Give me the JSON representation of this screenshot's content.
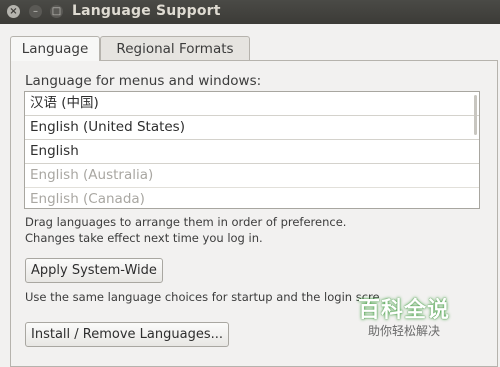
{
  "window": {
    "title": "Language Support",
    "close_glyph": "×",
    "minimize_glyph": "–",
    "maximize_glyph": "□"
  },
  "tabs": [
    {
      "label": "Language"
    },
    {
      "label": "Regional Formats"
    }
  ],
  "language": {
    "list_label": "Language for menus and windows:",
    "items": [
      {
        "label": "汉语 (中国)"
      },
      {
        "label": "English (United States)"
      },
      {
        "label": "English"
      },
      {
        "label": "English (Australia)"
      },
      {
        "label": "English (Canada)"
      }
    ],
    "drag_hint": "Drag languages to arrange them in order of preference.",
    "effect_hint": "Changes take effect next time you log in.",
    "apply_button": "Apply System-Wide",
    "startup_hint": "Use the same language choices for startup and the login scre",
    "install_button": "Install / Remove Languages..."
  },
  "watermark": {
    "main": "百科全说",
    "sub": "助你轻松解决"
  },
  "colors": {
    "titlebar": "#3c3b37",
    "window_bg": "#f2f1f0",
    "watermark_green": "#3a9d3a"
  }
}
